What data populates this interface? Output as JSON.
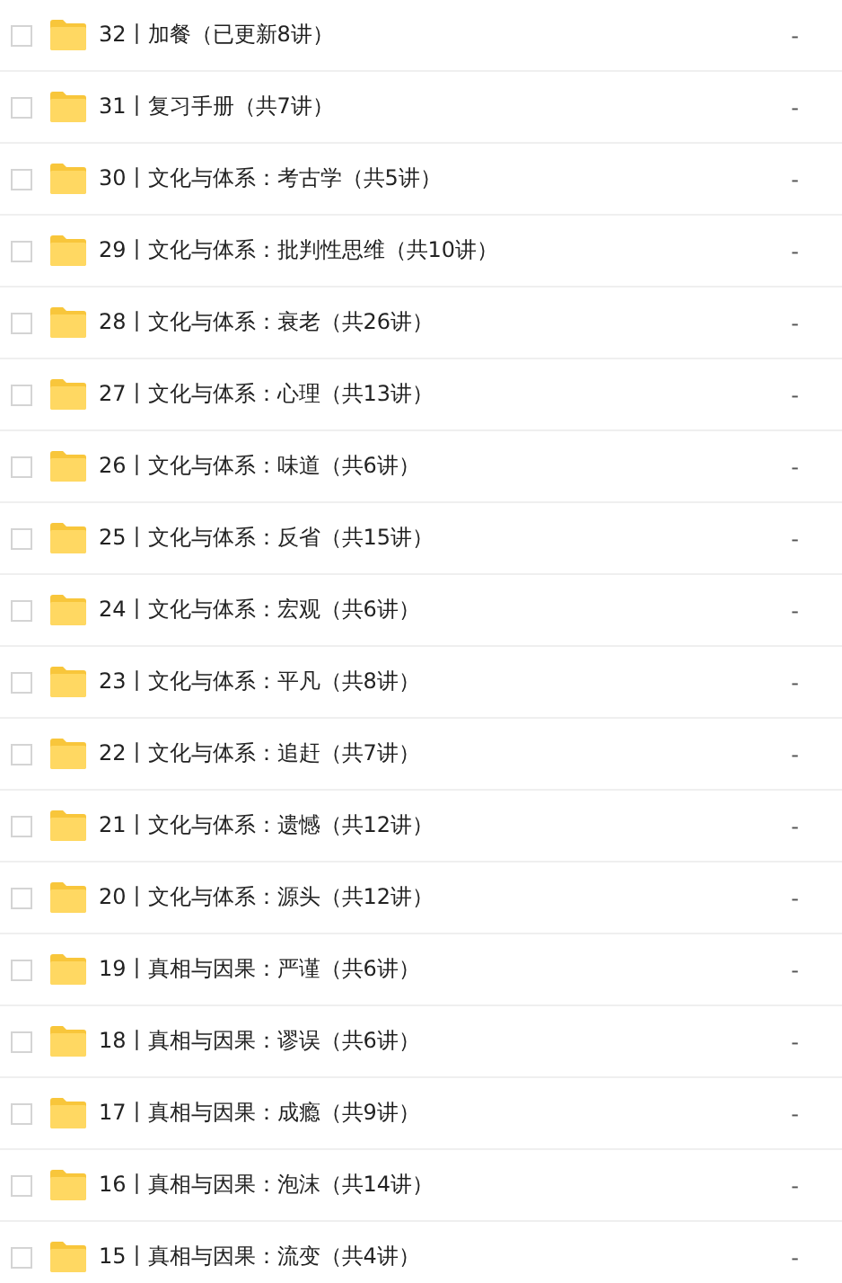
{
  "files": [
    {
      "name": "32丨加餐（已更新8讲）",
      "size": "-",
      "checked": false
    },
    {
      "name": "31丨复习手册（共7讲）",
      "size": "-",
      "checked": false
    },
    {
      "name": "30丨文化与体系：考古学（共5讲）",
      "size": "-",
      "checked": false
    },
    {
      "name": "29丨文化与体系：批判性思维（共10讲）",
      "size": "-",
      "checked": false
    },
    {
      "name": "28丨文化与体系：衰老（共26讲）",
      "size": "-",
      "checked": false
    },
    {
      "name": "27丨文化与体系：心理（共13讲）",
      "size": "-",
      "checked": false
    },
    {
      "name": "26丨文化与体系：味道（共6讲）",
      "size": "-",
      "checked": false
    },
    {
      "name": "25丨文化与体系：反省（共15讲）",
      "size": "-",
      "checked": false
    },
    {
      "name": "24丨文化与体系：宏观（共6讲）",
      "size": "-",
      "checked": false
    },
    {
      "name": "23丨文化与体系：平凡（共8讲）",
      "size": "-",
      "checked": false
    },
    {
      "name": "22丨文化与体系：追赶（共7讲）",
      "size": "-",
      "checked": false
    },
    {
      "name": "21丨文化与体系：遗憾（共12讲）",
      "size": "-",
      "checked": false
    },
    {
      "name": "20丨文化与体系：源头（共12讲）",
      "size": "-",
      "checked": false
    },
    {
      "name": "19丨真相与因果：严谨（共6讲）",
      "size": "-",
      "checked": false
    },
    {
      "name": "18丨真相与因果：谬误（共6讲）",
      "size": "-",
      "checked": false
    },
    {
      "name": "17丨真相与因果：成瘾（共9讲）",
      "size": "-",
      "checked": false
    },
    {
      "name": "16丨真相与因果：泡沫（共14讲）",
      "size": "-",
      "checked": false
    },
    {
      "name": "15丨真相与因果：流变（共4讲）",
      "size": "-",
      "checked": false
    }
  ]
}
